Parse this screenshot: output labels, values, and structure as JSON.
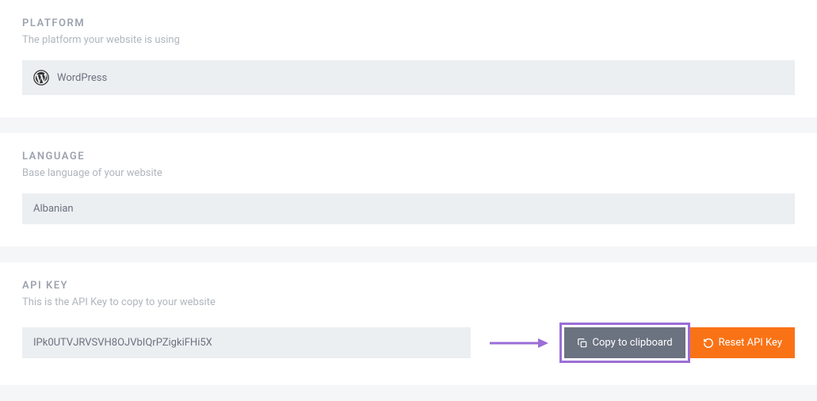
{
  "platform": {
    "title": "PLATFORM",
    "description": "The platform your website is using",
    "value": "WordPress",
    "icon": "wordpress-icon"
  },
  "language": {
    "title": "LANGUAGE",
    "description": "Base language of your website",
    "value": "Albanian"
  },
  "api_key": {
    "title": "API KEY",
    "description": "This is the API Key to copy to your website",
    "value": "IPk0UTVJRVSVH8OJVbIQrPZigkiFHi5X",
    "copy_label": "Copy to clipboard",
    "reset_label": "Reset API Key"
  },
  "colors": {
    "accent_orange": "#f97316",
    "btn_dark": "#6b7280",
    "highlight": "#9b6dd7"
  }
}
